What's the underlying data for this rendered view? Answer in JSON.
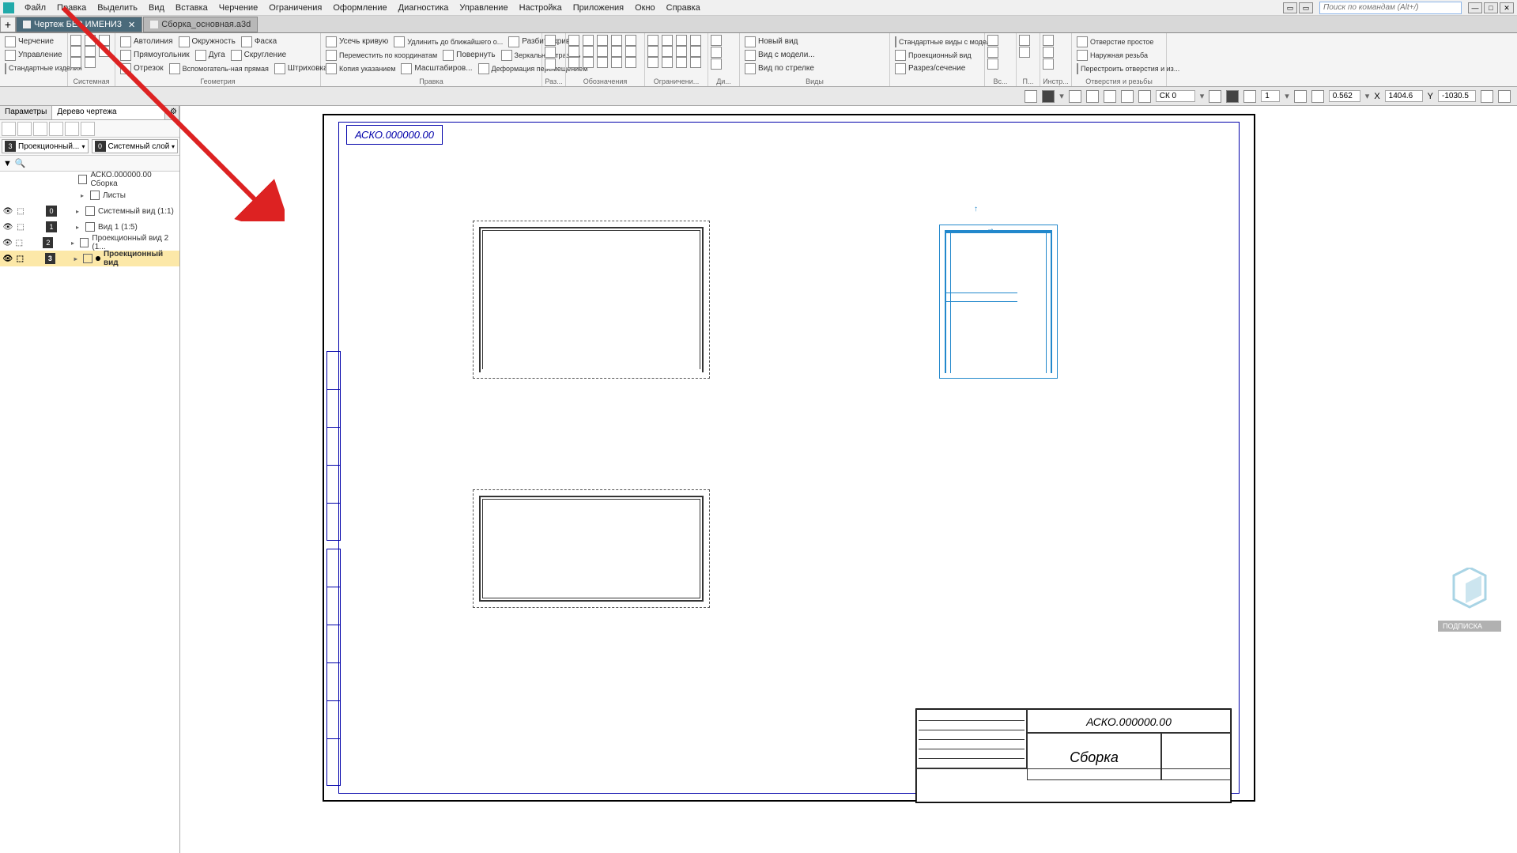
{
  "menu": [
    "Файл",
    "Правка",
    "Выделить",
    "Вид",
    "Вставка",
    "Черчение",
    "Ограничения",
    "Оформление",
    "Диагностика",
    "Управление",
    "Настройка",
    "Приложения",
    "Окно",
    "Справка"
  ],
  "search_placeholder": "Поиск по командам (Alt+/)",
  "tabs": [
    {
      "label": "Чертеж БЕЗ ИМЕНИ3",
      "active": true
    },
    {
      "label": "Сборка_основная.a3d",
      "active": false
    }
  ],
  "ribbon": {
    "sections": [
      {
        "label": "",
        "items": [
          "Черчение",
          "Управление",
          "Стандартные изделия"
        ]
      },
      {
        "label": "Системная",
        "items": []
      },
      {
        "label": "Геометрия",
        "items": [
          "Автолиния",
          "Прямоугольник",
          "Отрезок",
          "Окружность",
          "Дуга",
          "Вспомогатель-ная прямая",
          "Фаска",
          "Скругление",
          "Штриховка"
        ]
      },
      {
        "label": "Правка",
        "items": [
          "Усечь кривую",
          "Переместить по координатам",
          "Копия указанием",
          "Удлинить до ближайшего о...",
          "Повернуть",
          "Масштабиров...",
          "Разбить кривую",
          "Зеркально отразить",
          "Деформация перемещением"
        ]
      },
      {
        "label": "Раз...",
        "items": []
      },
      {
        "label": "Обозначения",
        "items": []
      },
      {
        "label": "Ограничени...",
        "items": []
      },
      {
        "label": "Ди...",
        "items": []
      },
      {
        "label": "Виды",
        "items": [
          "Новый вид",
          "Вид с модели...",
          "Вид по стрелке",
          "Стандартные виды с модел...",
          "Проекционный вид",
          "Разрез/сечение"
        ]
      },
      {
        "label": "Вс...",
        "items": []
      },
      {
        "label": "П...",
        "items": []
      },
      {
        "label": "Инстр...",
        "items": []
      },
      {
        "label": "Отверстия и резьбы",
        "items": [
          "Отверстие простое",
          "Наружная резьба",
          "Перестроить отверстия и из..."
        ]
      }
    ]
  },
  "statusbar": {
    "cs": "СК 0",
    "scale": "1",
    "zoom": "0.562",
    "x": "1404.6",
    "y": "-1030.5",
    "xlabel": "X",
    "ylabel": "Y"
  },
  "leftpanel": {
    "tab1": "Параметры",
    "tab2": "Дерево чертежа",
    "select1": "Проекционный...",
    "select1_num": "3",
    "select2": "Системный слой",
    "select2_num": "0",
    "root": "АСКО.000000.00 Сборка",
    "nodes": [
      {
        "label": "Листы",
        "indent": 1
      },
      {
        "label": "Системный вид (1:1)",
        "num": "0",
        "indent": 1
      },
      {
        "label": "Вид 1 (1:5)",
        "num": "1",
        "indent": 1
      },
      {
        "label": "Проекционный вид 2 (1...",
        "num": "2",
        "indent": 1
      },
      {
        "label": "Проекционный вид",
        "num": "3",
        "indent": 1,
        "selected": true
      }
    ]
  },
  "canvas": {
    "view_label": "АСКО.000000.00",
    "title_block": {
      "code": "АСКО.000000.00",
      "name": "Сборка"
    }
  },
  "watermark": "ПОДПИСКА"
}
